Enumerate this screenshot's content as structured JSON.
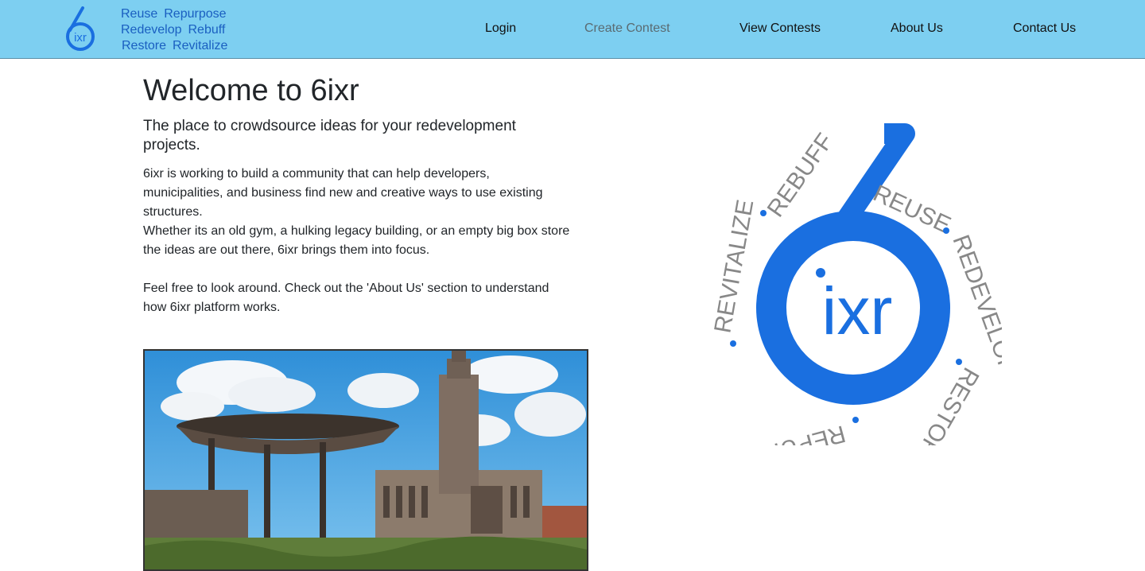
{
  "header": {
    "logo_text": "ixr",
    "tagline": {
      "row1": [
        "Reuse",
        "Repurpose"
      ],
      "row2": [
        "Redevelop",
        "Rebuff"
      ],
      "row3": [
        "Restore",
        "Revitalize"
      ]
    },
    "nav": {
      "login": "Login",
      "create_contest": "Create Contest",
      "view_contests": "View Contests",
      "about_us": "About Us",
      "contact_us": "Contact Us"
    }
  },
  "main": {
    "title": "Welcome to 6ixr",
    "lead": "The place to crowdsource ideas for your redevelopment projects.",
    "paragraph1": "6ixr is working to build a community that can help developers, municipalities, and business find new and creative ways to use existing structures.",
    "paragraph2": "Whether its an old gym, a hulking legacy building, or an empty big box store the ideas are out there, 6ixr brings them into focus.",
    "paragraph3": "Feel free to look around. Check out the 'About Us' section to understand how 6ixr platform works."
  },
  "emblem": {
    "center_text": "ixr",
    "ring_words": [
      "REUSE",
      "REDEVELOP",
      "RESTORE",
      "REPURPOSE",
      "REVITALIZE",
      "REBUFF"
    ]
  },
  "colors": {
    "navbar_bg": "#7dcff1",
    "brand_blue": "#1a6fe0",
    "tagline_blue": "#1a5fc1",
    "muted_nav": "#5a6b72"
  }
}
